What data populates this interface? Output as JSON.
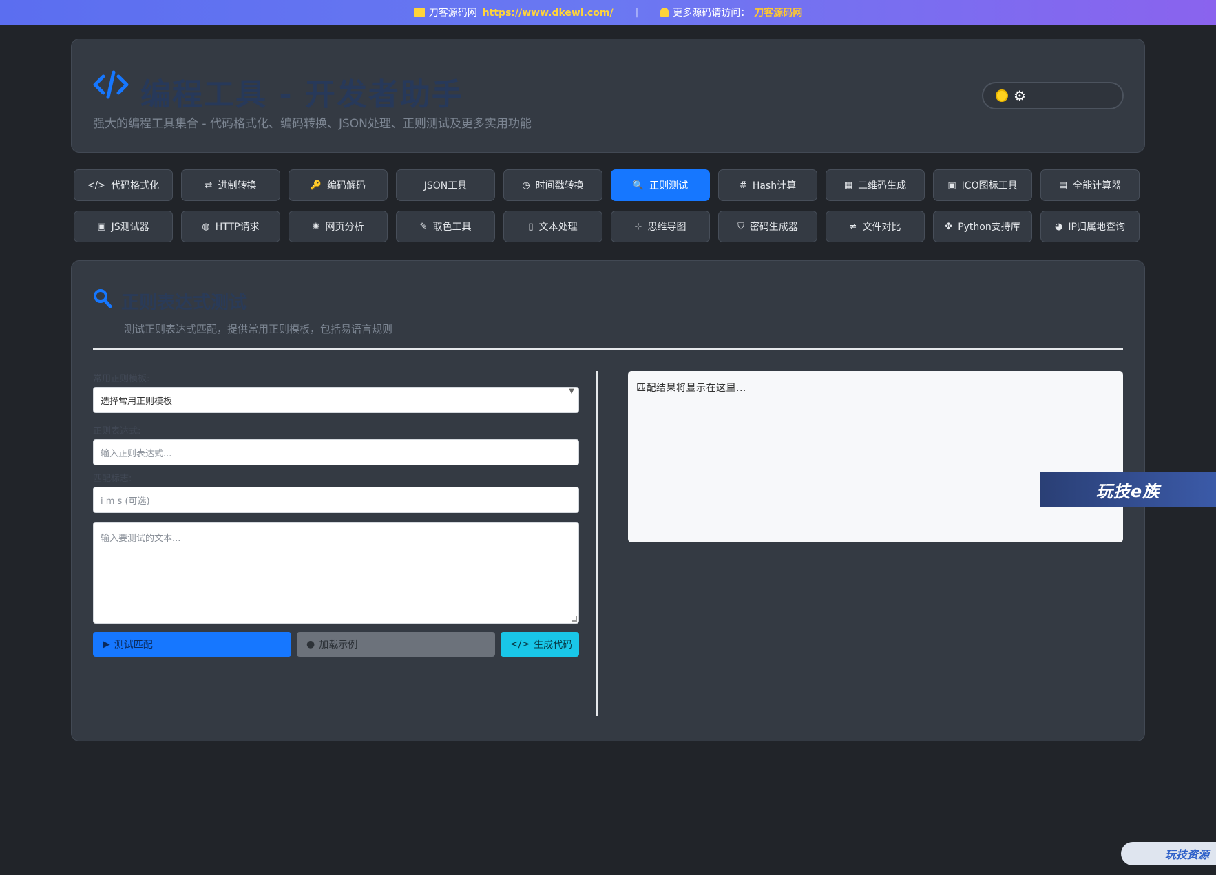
{
  "banner": {
    "site_name": "刀客源码网",
    "site_url": "https://www.dkewl.com/",
    "separator": "|",
    "more_text": "更多源码请访问：",
    "more_link": "刀客源码网"
  },
  "header": {
    "title": "编程工具 - 开发者助手",
    "subtitle": "强大的编程工具集合 - 代码格式化、编码转换、JSON处理、正则测试及更多实用功能"
  },
  "nav": {
    "items": [
      {
        "label": "代码格式化",
        "icon": "code-icon",
        "glyph": "</>"
      },
      {
        "label": "进制转换",
        "icon": "swap-icon",
        "glyph": "⇄"
      },
      {
        "label": "编码解码",
        "icon": "key-icon",
        "glyph": "🔑"
      },
      {
        "label": "JSON工具",
        "icon": "",
        "glyph": ""
      },
      {
        "label": "时间戳转换",
        "icon": "clock-icon",
        "glyph": "◷"
      },
      {
        "label": "正则测试",
        "icon": "search-icon",
        "glyph": "🔍"
      },
      {
        "label": "Hash计算",
        "icon": "hash-icon",
        "glyph": "#"
      },
      {
        "label": "二维码生成",
        "icon": "qrcode-icon",
        "glyph": "▦"
      },
      {
        "label": "ICO图标工具",
        "icon": "image-icon",
        "glyph": "▣"
      },
      {
        "label": "全能计算器",
        "icon": "calculator-icon",
        "glyph": "▤"
      },
      {
        "label": "JS测试器",
        "icon": "js-icon",
        "glyph": "▣"
      },
      {
        "label": "HTTP请求",
        "icon": "globe-icon",
        "glyph": "◍"
      },
      {
        "label": "网页分析",
        "icon": "bug-icon",
        "glyph": "✺"
      },
      {
        "label": "取色工具",
        "icon": "eyedropper-icon",
        "glyph": "✎"
      },
      {
        "label": "文本处理",
        "icon": "file-icon",
        "glyph": "▯"
      },
      {
        "label": "思维导图",
        "icon": "sitemap-icon",
        "glyph": "⊹"
      },
      {
        "label": "密码生成器",
        "icon": "shield-icon",
        "glyph": "⛉"
      },
      {
        "label": "文件对比",
        "icon": "not-equal-icon",
        "glyph": "≠"
      },
      {
        "label": "Python支持库",
        "icon": "python-icon",
        "glyph": "✤"
      },
      {
        "label": "IP归属地查询",
        "icon": "globe-icon",
        "glyph": "◕"
      }
    ],
    "active_index": 5
  },
  "panel": {
    "title": "正则表达式测试",
    "description": "测试正则表达式匹配，提供常用正则模板，包括易语言规则",
    "template_label": "常用正则模板:",
    "template_value": "选择常用正则模板",
    "regex_label": "正则表达式:",
    "regex_placeholder": "输入正则表达式...",
    "flags_label": "匹配标志:",
    "flags_placeholder": "i m s (可选)",
    "text_placeholder": "输入要测试的文本...",
    "btn_test": "测试匹配",
    "btn_example": "加载示例",
    "btn_generate": "生成代码",
    "result_placeholder": "匹配结果将显示在这里..."
  },
  "watermarks": {
    "badge1": "玩技e族",
    "badge2": "玩技资源"
  },
  "colors": {
    "accent": "#1677ff",
    "cyan": "#19c6e8",
    "background": "#212429",
    "card": "#343a43"
  }
}
